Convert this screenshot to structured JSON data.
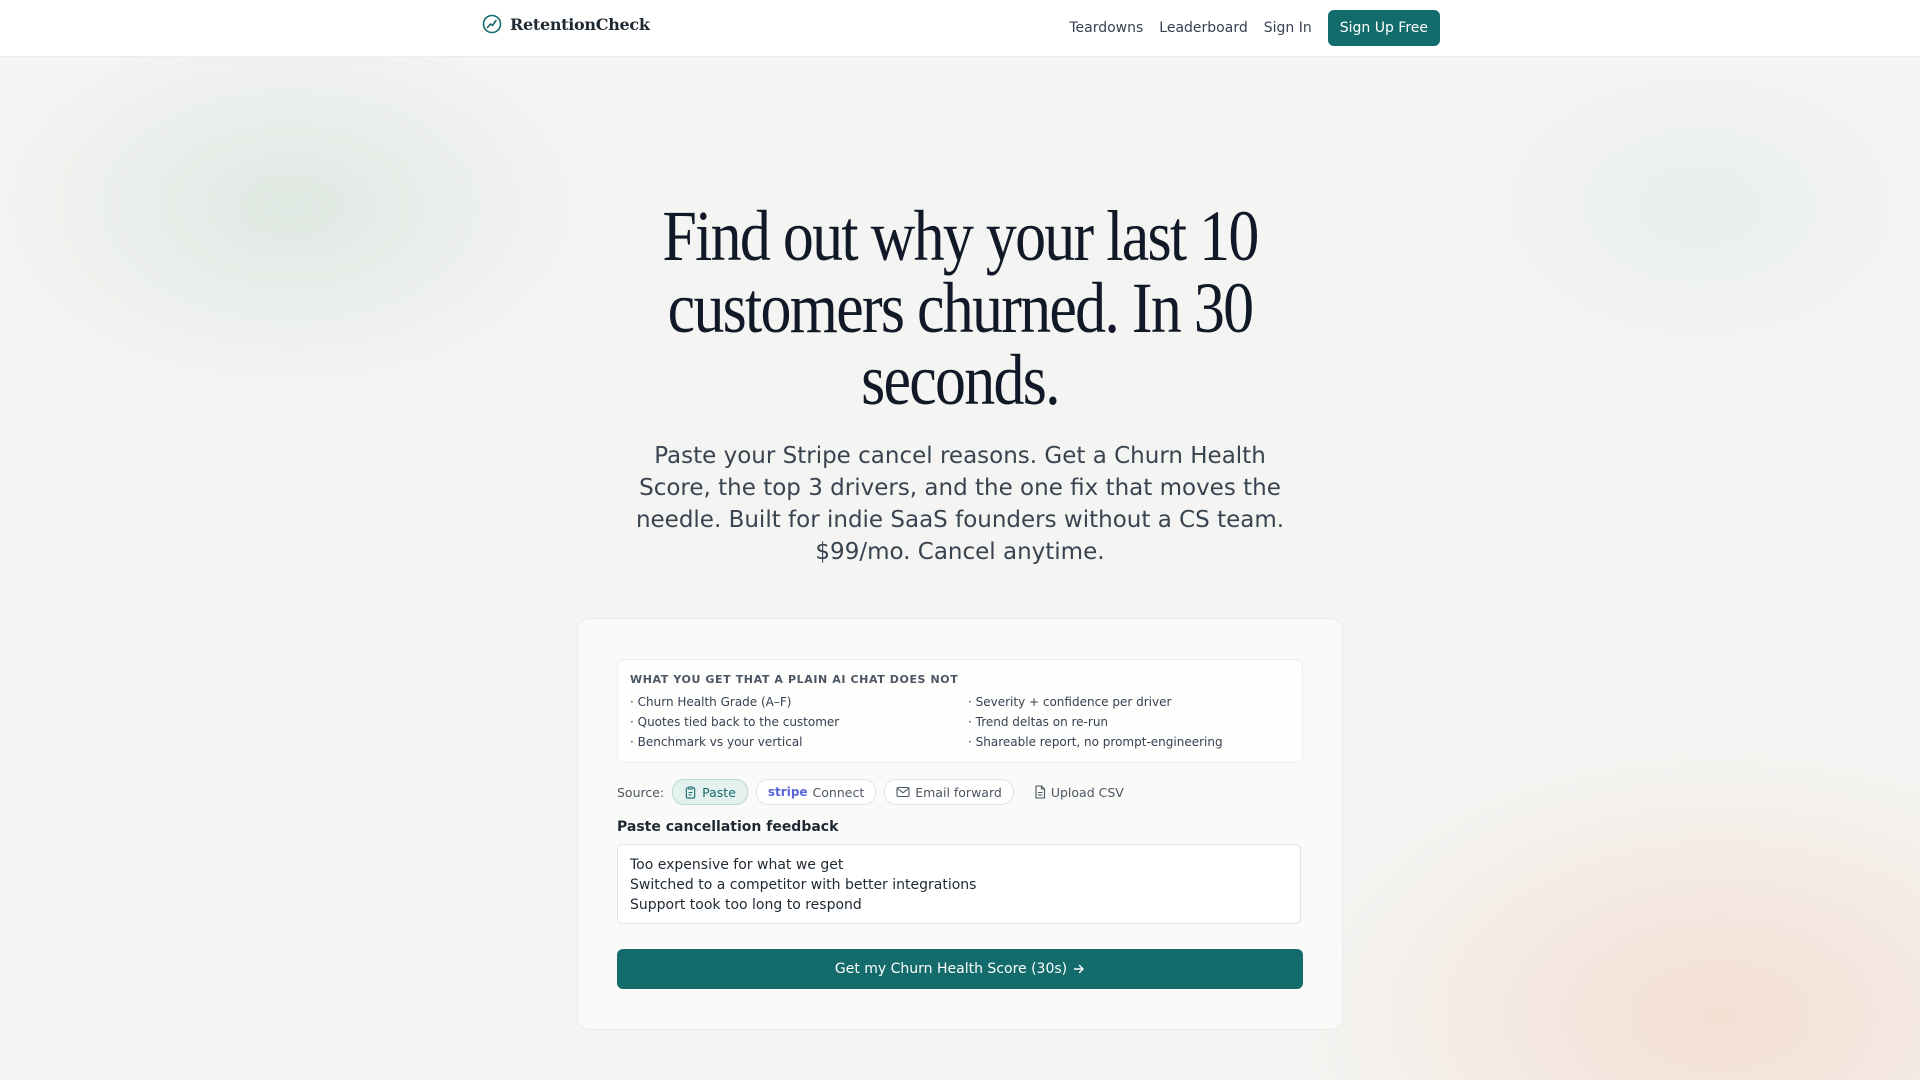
{
  "header": {
    "brand": "RetentionCheck",
    "nav": {
      "teardowns": "Teardowns",
      "leaderboard": "Leaderboard",
      "sign_in": "Sign In",
      "sign_up": "Sign Up Free"
    }
  },
  "hero": {
    "title": "Find out why your last 10 customers churned. In 30 seconds.",
    "subtitle": "Paste your Stripe cancel reasons. Get a Churn Health Score, the top 3 drivers, and the one fix that moves the needle. Built for indie SaaS founders without a CS team. $99/mo. Cancel anytime."
  },
  "features": {
    "heading": "WHAT YOU GET THAT A PLAIN AI CHAT DOES NOT",
    "items": [
      "· Churn Health Grade (A–F)",
      "· Severity + confidence per driver",
      "· Quotes tied back to the customer",
      "· Trend deltas on re-run",
      "· Benchmark vs your vertical",
      "· Shareable report, no prompt-engineering"
    ]
  },
  "source": {
    "label": "Source:",
    "paste": "Paste",
    "stripe_brand": "stripe",
    "connect": "Connect",
    "email": "Email forward",
    "csv": "Upload CSV"
  },
  "form": {
    "label": "Paste cancellation feedback",
    "value": "Too expensive for what we get\nSwitched to a competitor with better integrations\nSupport took too long to respond",
    "cta": "Get my Churn Health Score (30s)"
  },
  "colors": {
    "accent": "#146b6b",
    "chip_active_bg": "#e5f1ee",
    "stripe": "#5a67d8"
  },
  "icons": [
    "logo-trend-icon",
    "paste-icon",
    "mail-icon",
    "file-icon",
    "arrow-right-icon"
  ]
}
